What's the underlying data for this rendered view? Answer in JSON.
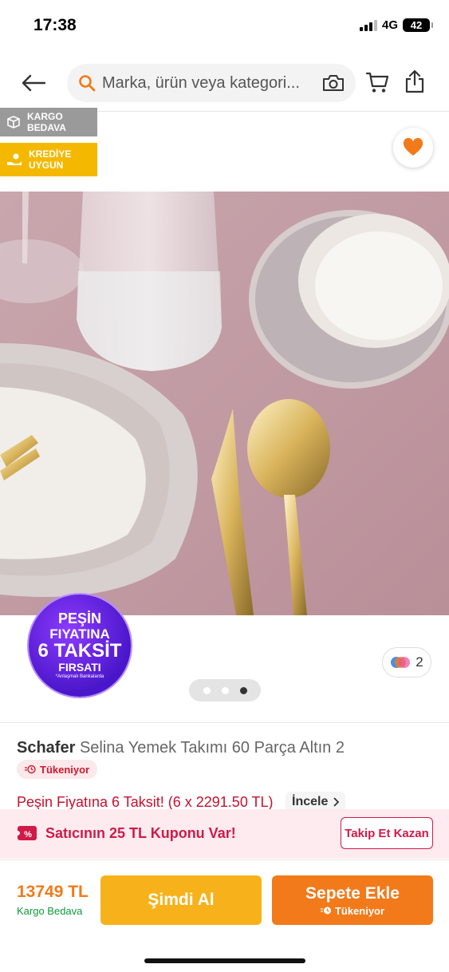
{
  "status_bar": {
    "time": "17:38",
    "network": "4G",
    "battery": "42"
  },
  "header": {
    "search_placeholder": "Marka, ürün veya kategori..."
  },
  "badges": {
    "kargo": {
      "line1": "KARGO",
      "line2": "BEDAVA"
    },
    "kredi": {
      "line1": "KREDİYE",
      "line2": "UYGUN"
    }
  },
  "promo_seal": {
    "line1": "PEŞİN",
    "line2": "FIYATINA",
    "line3": "6 TAKSİT",
    "line4": "FIRSATI",
    "line5": "*Anlaşmalı Bankalarda"
  },
  "gallery": {
    "color_count": "2",
    "page_count": 3,
    "active_page": 3
  },
  "product": {
    "brand": "Schafer",
    "name": "Selina Yemek Takımı 60 Parça Altın 2",
    "stock_label": "Tükeniyor",
    "installment_text": "Peşin Fiyatına 6 Taksit! (6 x 2291.50 TL)",
    "incele_label": "İncele"
  },
  "coupon": {
    "text": "Satıcının 25 TL Kuponu Var!",
    "follow_label": "Takip Et Kazan"
  },
  "bottom_bar": {
    "price": "13749 TL",
    "shipping": "Kargo Bedava",
    "buy_now_label": "Şimdi Al",
    "add_to_cart_label": "Sepete Ekle",
    "add_to_cart_sub": "Tükeniyor"
  },
  "colors": {
    "brand_orange": "#f27a1a",
    "buy_now_yellow": "#f7b21b",
    "alert_red": "#c8102e",
    "coupon_pink": "#d01a47"
  }
}
